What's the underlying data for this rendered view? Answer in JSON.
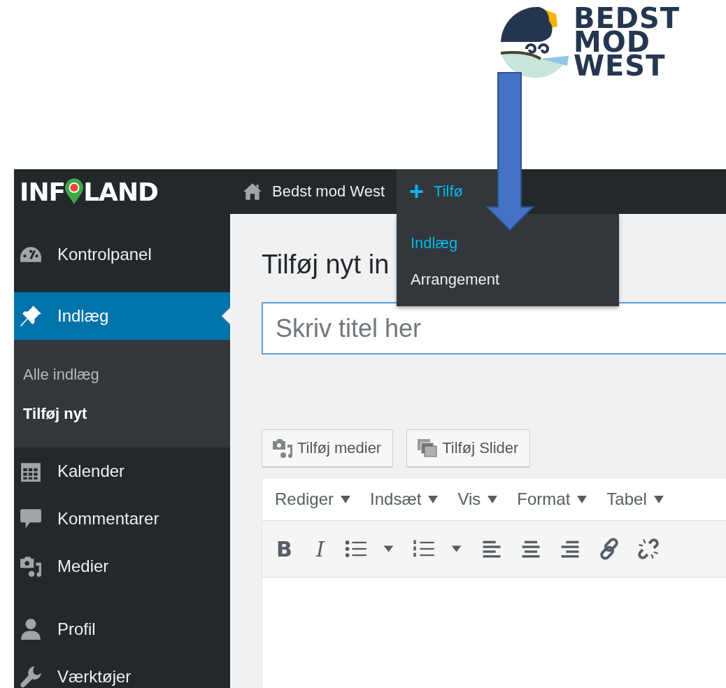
{
  "logo": {
    "lines": [
      "BEDST",
      "MOD",
      "WEST"
    ]
  },
  "admin_bar": {
    "brand": {
      "before": "INF",
      "after": "LAND"
    },
    "site": "Bedst mod West",
    "new": {
      "icon": "+",
      "label": "Tilfø"
    },
    "new_menu": [
      {
        "label": "Indlæg",
        "selected": true
      },
      {
        "label": "Arrangement",
        "selected": false
      }
    ]
  },
  "sidebar": {
    "items": [
      {
        "kind": "dashboard",
        "label": "Kontrolpanel",
        "selected": false
      },
      {
        "kind": "pin",
        "label": "Indlæg",
        "selected": true,
        "children": [
          {
            "label": "Alle indlæg",
            "selected": false
          },
          {
            "label": "Tilføj nyt",
            "selected": true
          }
        ]
      },
      {
        "kind": "calendar",
        "label": "Kalender",
        "selected": false
      },
      {
        "kind": "comment",
        "label": "Kommentarer",
        "selected": false
      },
      {
        "kind": "media",
        "label": "Medier",
        "selected": false
      },
      {
        "kind": "user",
        "label": "Profil",
        "selected": false
      },
      {
        "kind": "wrench",
        "label": "Værktøjer",
        "selected": false
      }
    ]
  },
  "page_title": "Tilføj nyt in",
  "title_field": {
    "placeholder": "Skriv titel her"
  },
  "media_buttons": [
    {
      "kind": "media",
      "label": "Tilføj medier"
    },
    {
      "kind": "slider",
      "label": "Tilføj Slider"
    }
  ],
  "editor": {
    "menubar": [
      "Rediger",
      "Indsæt",
      "Vis",
      "Format",
      "Tabel"
    ],
    "toolbar": [
      {
        "kind": "bold",
        "label": "B"
      },
      {
        "kind": "italic",
        "label": "I"
      },
      {
        "kind": "bullets"
      },
      {
        "kind": "numbers"
      },
      {
        "kind": "align-left"
      },
      {
        "kind": "align-center"
      },
      {
        "kind": "align-right"
      },
      {
        "kind": "link"
      },
      {
        "kind": "unlink"
      }
    ]
  }
}
